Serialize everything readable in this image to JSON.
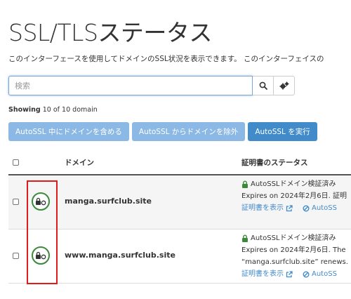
{
  "page": {
    "title": "SSL/TLSステータス",
    "description": "このインターフェースを使用してドメインのSSL状況を表示できます。 このインターフェイスの"
  },
  "search": {
    "placeholder": "検索",
    "search_icon": "search-icon",
    "settings_icon": "gears-icon"
  },
  "showing": {
    "label": "Showing",
    "text": "10 of 10 domain"
  },
  "actions": {
    "include_label": "AutoSSL 中にドメインを含める",
    "exclude_label": "AutoSSL からドメインを除外",
    "run_label": "AutoSSL を実行"
  },
  "table": {
    "headers": {
      "domain": "ドメイン",
      "status": "証明書のステータス"
    },
    "rows": [
      {
        "domain": "manga.surfclub.site",
        "status_title": "AutoSSLドメイン検証済み",
        "status_detail": "Expires on 2024年2月6日. 証明",
        "status_detail2": "",
        "view_cert": "証明書を表示",
        "exclude_link": "AutoSS"
      },
      {
        "domain": "www.manga.surfclub.site",
        "status_title": "AutoSSLドメイン検証済み",
        "status_detail": "Expires on 2024年2月6日. The",
        "status_detail2": "“manga.surfclub.site” renews.",
        "view_cert": "証明書を表示",
        "exclude_link": "AutoSS"
      }
    ]
  },
  "colors": {
    "primary": "#428bca",
    "disabled": "#8bb8e4",
    "success": "#3a8a3a",
    "highlight": "#e01b1b"
  }
}
